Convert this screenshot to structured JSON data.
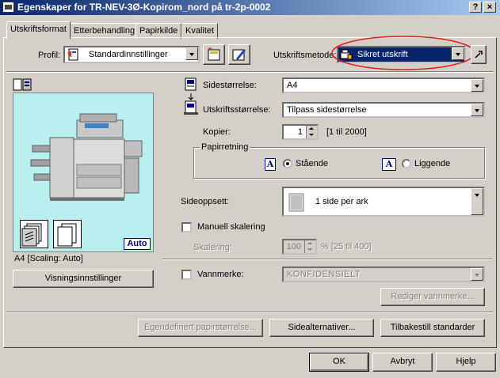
{
  "window": {
    "title": "Egenskaper for TR-NEV-3Ø-Kopirom_nord på tr-2p-0002",
    "help_btn": "?",
    "close_btn": "×"
  },
  "tabs": [
    {
      "label": "Utskriftsformat"
    },
    {
      "label": "Etterbehandling"
    },
    {
      "label": "Papirkilde"
    },
    {
      "label": "Kvalitet"
    }
  ],
  "profile": {
    "label": "Profil:",
    "value": "Standardinnstillinger"
  },
  "output_method": {
    "label": "Utskriftsmetode:",
    "value": "Sikret utskrift",
    "highlight_color": "#e02020"
  },
  "preview": {
    "caption": "A4 [Scaling: Auto]",
    "auto_badge": "Auto",
    "settings_button": "Visningsinnstillinger",
    "bg_color": "#b8f0f0"
  },
  "page_size": {
    "label": "Sidestørrelse:",
    "value": "A4"
  },
  "output_size": {
    "label": "Utskriftsstørrelse:",
    "value": "Tilpass sidestørrelse"
  },
  "copies": {
    "label": "Kopier:",
    "value": "1",
    "range": "[1 til 2000]"
  },
  "orientation": {
    "group_label": "Papirretning",
    "portrait": "Stående",
    "landscape": "Liggende",
    "icon_letter": "A"
  },
  "layout": {
    "label": "Sideoppsett:",
    "value": "1 side per ark"
  },
  "manual_scaling": {
    "label": "Manuell skalering",
    "scaling_label": "Skalering:",
    "value": "100",
    "range": "% [25 til 400]"
  },
  "watermark": {
    "label": "Vannmerke:",
    "value": "KONFIDENSIELT",
    "edit_button": "Rediger vannmerke..."
  },
  "bottom_buttons": {
    "custom_size": "Egendefinert papirstørrelse...",
    "page_options": "Sidealternativer...",
    "restore_defaults": "Tilbakestill standarder"
  },
  "dialog_buttons": {
    "ok": "OK",
    "cancel": "Avbryt",
    "help": "Hjelp"
  }
}
